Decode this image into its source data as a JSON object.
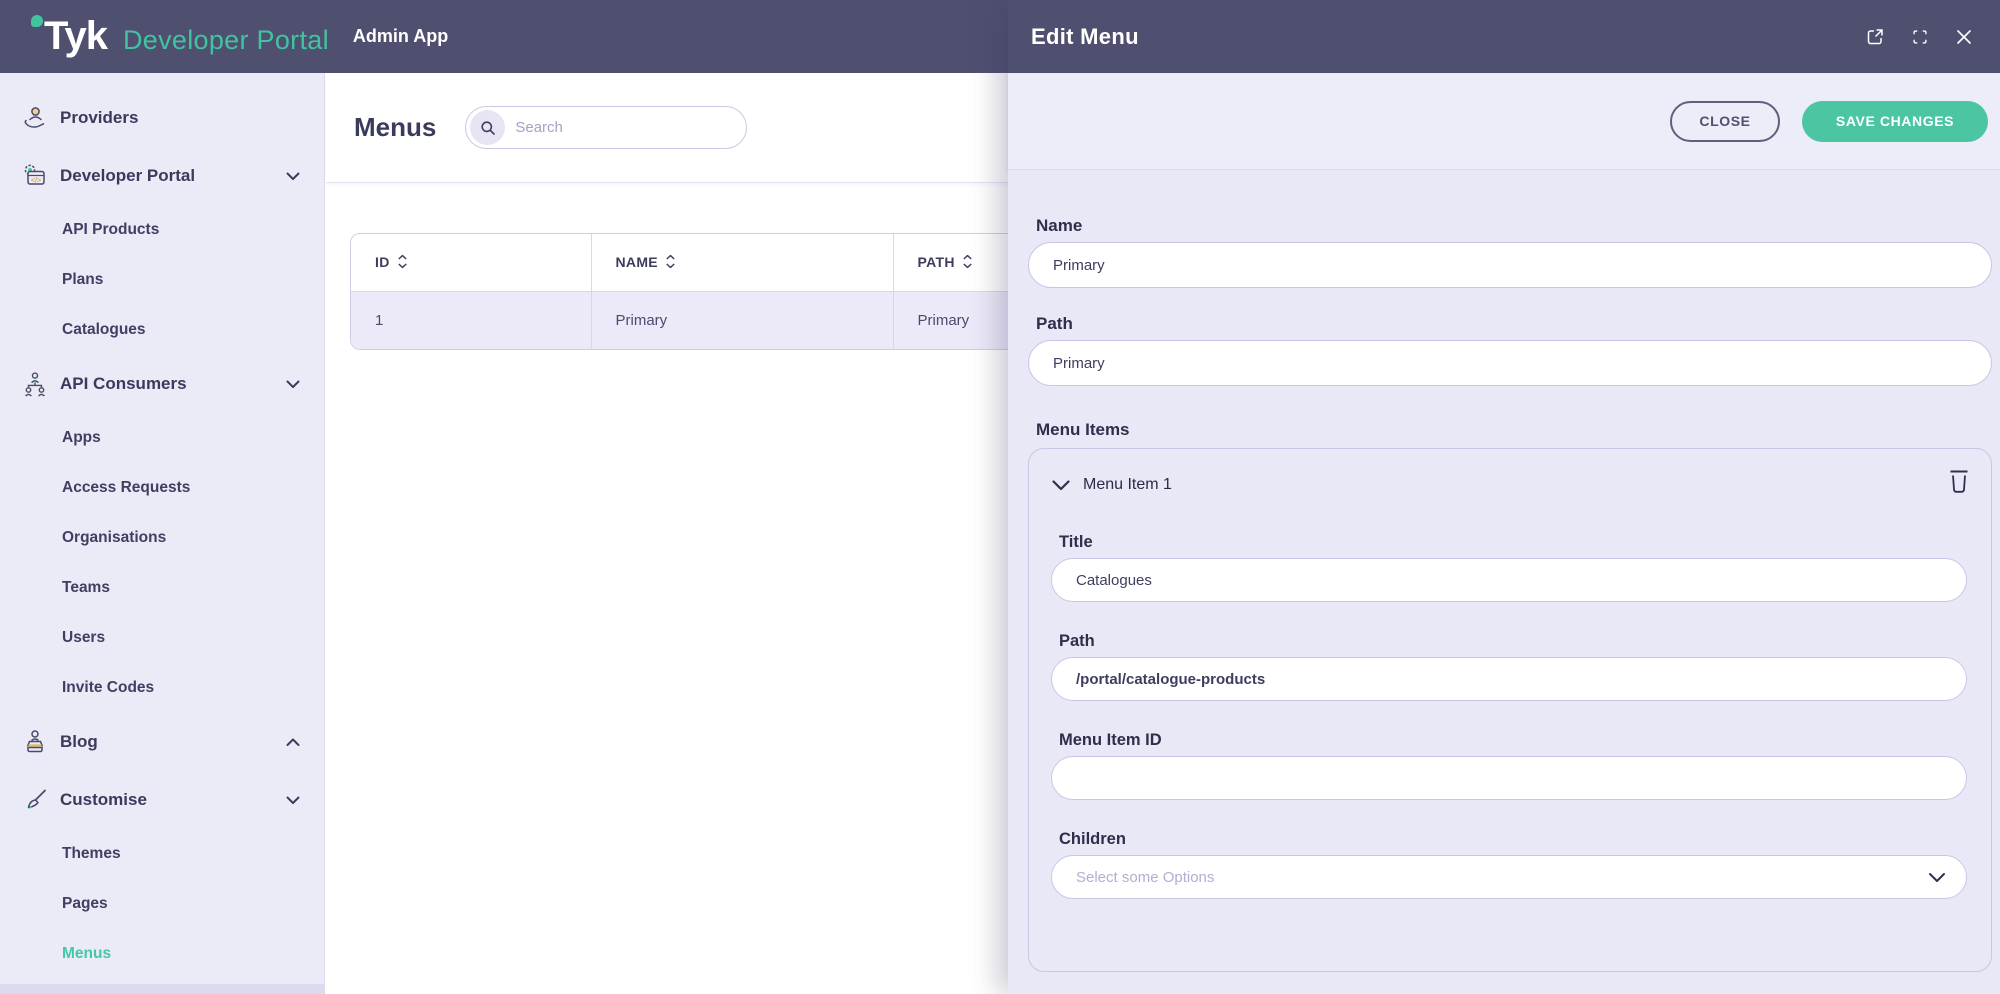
{
  "header": {
    "brand": "Tyk",
    "product": "Developer Portal",
    "app": "Admin App"
  },
  "sidebar": {
    "items": [
      {
        "label": "Providers",
        "type": "top",
        "icon": "providers"
      },
      {
        "label": "Developer Portal",
        "type": "top",
        "icon": "developer-portal",
        "chevron": "down"
      },
      {
        "label": "API Products",
        "type": "sub"
      },
      {
        "label": "Plans",
        "type": "sub"
      },
      {
        "label": "Catalogues",
        "type": "sub"
      },
      {
        "label": "API Consumers",
        "type": "top",
        "icon": "api-consumers",
        "chevron": "down"
      },
      {
        "label": "Apps",
        "type": "sub"
      },
      {
        "label": "Access Requests",
        "type": "sub"
      },
      {
        "label": "Organisations",
        "type": "sub"
      },
      {
        "label": "Teams",
        "type": "sub"
      },
      {
        "label": "Users",
        "type": "sub"
      },
      {
        "label": "Invite Codes",
        "type": "sub"
      },
      {
        "label": "Blog",
        "type": "top",
        "icon": "blog",
        "chevron": "up"
      },
      {
        "label": "Customise",
        "type": "top",
        "icon": "customise",
        "chevron": "down"
      },
      {
        "label": "Themes",
        "type": "sub"
      },
      {
        "label": "Pages",
        "type": "sub"
      },
      {
        "label": "Menus",
        "type": "sub",
        "active": true
      }
    ]
  },
  "main": {
    "title": "Menus",
    "search_placeholder": "Search",
    "table": {
      "columns": [
        "ID",
        "NAME",
        "PATH"
      ],
      "rows": [
        {
          "id": "1",
          "name": "Primary",
          "path": "Primary"
        }
      ]
    }
  },
  "drawer": {
    "title": "Edit Menu",
    "toolbar": {
      "close_label": "CLOSE",
      "save_label": "SAVE CHANGES"
    },
    "fields": {
      "name": {
        "label": "Name",
        "value": "Primary"
      },
      "path": {
        "label": "Path",
        "value": "Primary"
      }
    },
    "menu_items": {
      "label": "Menu Items",
      "item": {
        "header": "Menu Item 1",
        "title": {
          "label": "Title",
          "value": "Catalogues"
        },
        "path": {
          "label": "Path",
          "value": "/portal/catalogue-products"
        },
        "menu_item_id": {
          "label": "Menu Item ID",
          "value": ""
        },
        "children": {
          "label": "Children",
          "placeholder": "Select some Options"
        }
      }
    }
  },
  "colors": {
    "accent_teal": "#4cc6a2",
    "header_purple": "#4f4f70",
    "sidebar_bg": "#ebeaf7"
  }
}
